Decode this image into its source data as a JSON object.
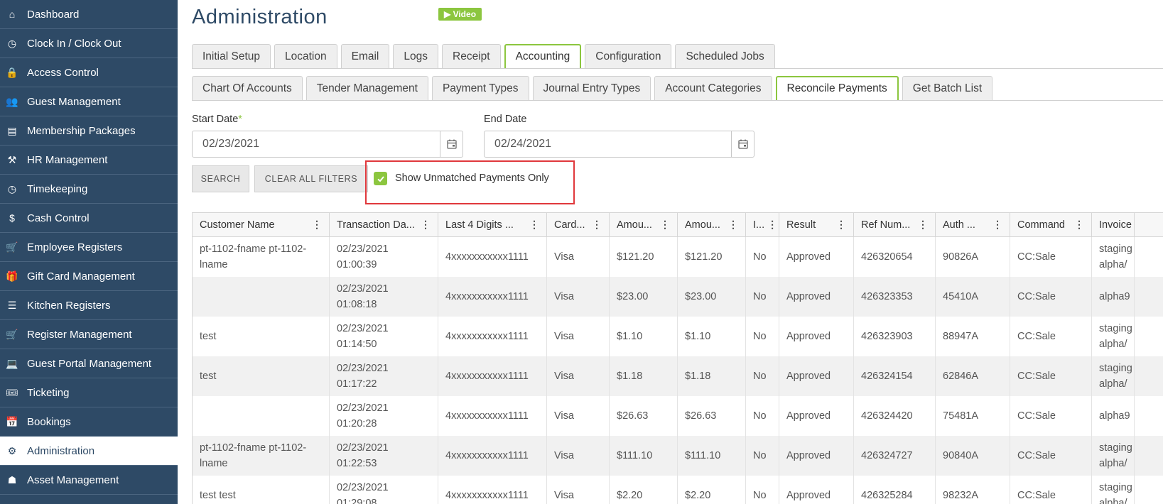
{
  "sidebar": {
    "items": [
      {
        "label": "Dashboard",
        "icon": "home-icon",
        "glyph": "⌂"
      },
      {
        "label": "Clock In / Clock Out",
        "icon": "clock-icon",
        "glyph": "◷"
      },
      {
        "label": "Access Control",
        "icon": "lock-icon",
        "glyph": "🔒"
      },
      {
        "label": "Guest Management",
        "icon": "users-icon",
        "glyph": "👥"
      },
      {
        "label": "Membership Packages",
        "icon": "packages-icon",
        "glyph": "▤"
      },
      {
        "label": "HR Management",
        "icon": "hr-icon",
        "glyph": "⚒"
      },
      {
        "label": "Timekeeping",
        "icon": "clock-icon",
        "glyph": "◷"
      },
      {
        "label": "Cash Control",
        "icon": "dollar-icon",
        "glyph": "$"
      },
      {
        "label": "Employee Registers",
        "icon": "cart-icon",
        "glyph": "🛒"
      },
      {
        "label": "Gift Card Management",
        "icon": "gift-icon",
        "glyph": "🎁"
      },
      {
        "label": "Kitchen Registers",
        "icon": "list-icon",
        "glyph": "☰"
      },
      {
        "label": "Register Management",
        "icon": "cart-icon",
        "glyph": "🛒"
      },
      {
        "label": "Guest Portal Management",
        "icon": "laptop-icon",
        "glyph": "💻"
      },
      {
        "label": "Ticketing",
        "icon": "ticket-icon",
        "glyph": "🎟"
      },
      {
        "label": "Bookings",
        "icon": "calendar-icon",
        "glyph": "📅"
      },
      {
        "label": "Administration",
        "icon": "gears-icon",
        "glyph": "⚙"
      },
      {
        "label": "Asset Management",
        "icon": "assets-icon",
        "glyph": "☗"
      }
    ],
    "active_index": 15
  },
  "header": {
    "title": "Administration",
    "video_label": "▶ Video"
  },
  "tabs_primary": [
    {
      "label": "Initial Setup"
    },
    {
      "label": "Location"
    },
    {
      "label": "Email"
    },
    {
      "label": "Logs"
    },
    {
      "label": "Receipt"
    },
    {
      "label": "Accounting",
      "active": true
    },
    {
      "label": "Configuration"
    },
    {
      "label": "Scheduled Jobs"
    }
  ],
  "tabs_secondary": [
    {
      "label": "Chart Of Accounts"
    },
    {
      "label": "Tender Management"
    },
    {
      "label": "Payment Types"
    },
    {
      "label": "Journal Entry Types"
    },
    {
      "label": "Account Categories"
    },
    {
      "label": "Reconcile Payments",
      "active": true
    },
    {
      "label": "Get Batch List"
    }
  ],
  "filters": {
    "start_label": "Start Date",
    "required_mark": "*",
    "start_value": "02/23/2021",
    "end_label": "End Date",
    "end_value": "02/24/2021",
    "search_label": "SEARCH",
    "clear_label": "CLEAR ALL FILTERS",
    "unmatched_label": "Show Unmatched Payments Only",
    "unmatched_checked": true
  },
  "table": {
    "columns": [
      "Customer Name",
      "Transaction Da...",
      "Last 4 Digits ...",
      "Card...",
      "Amou...",
      "Amou...",
      "I...",
      "Result",
      "Ref Num...",
      "Auth ...",
      "Command",
      "Invoice"
    ],
    "rows": [
      [
        "pt-1102-fname pt-1102-lname",
        "02/23/2021 01:00:39",
        "4xxxxxxxxxxx1111",
        "Visa",
        "$121.20",
        "$121.20",
        "No",
        "Approved",
        "426320654",
        "90826A",
        "CC:Sale",
        "staging alpha/"
      ],
      [
        "",
        "02/23/2021 01:08:18",
        "4xxxxxxxxxxx1111",
        "Visa",
        "$23.00",
        "$23.00",
        "No",
        "Approved",
        "426323353",
        "45410A",
        "CC:Sale",
        "alpha9"
      ],
      [
        "test",
        "02/23/2021 01:14:50",
        "4xxxxxxxxxxx1111",
        "Visa",
        "$1.10",
        "$1.10",
        "No",
        "Approved",
        "426323903",
        "88947A",
        "CC:Sale",
        "staging alpha/"
      ],
      [
        "test",
        "02/23/2021 01:17:22",
        "4xxxxxxxxxxx1111",
        "Visa",
        "$1.18",
        "$1.18",
        "No",
        "Approved",
        "426324154",
        "62846A",
        "CC:Sale",
        "staging alpha/"
      ],
      [
        "",
        "02/23/2021 01:20:28",
        "4xxxxxxxxxxx1111",
        "Visa",
        "$26.63",
        "$26.63",
        "No",
        "Approved",
        "426324420",
        "75481A",
        "CC:Sale",
        "alpha9"
      ],
      [
        "pt-1102-fname pt-1102-lname",
        "02/23/2021 01:22:53",
        "4xxxxxxxxxxx1111",
        "Visa",
        "$111.10",
        "$111.10",
        "No",
        "Approved",
        "426324727",
        "90840A",
        "CC:Sale",
        "staging alpha/"
      ],
      [
        "test test",
        "02/23/2021 01:29:08",
        "4xxxxxxxxxxx1111",
        "Visa",
        "$2.20",
        "$2.20",
        "No",
        "Approved",
        "426325284",
        "98232A",
        "CC:Sale",
        "staging alpha/"
      ]
    ]
  },
  "colors": {
    "sidebar_bg": "#2e4a66",
    "accent_green": "#8cc63f",
    "highlight_red": "#e0383c"
  }
}
